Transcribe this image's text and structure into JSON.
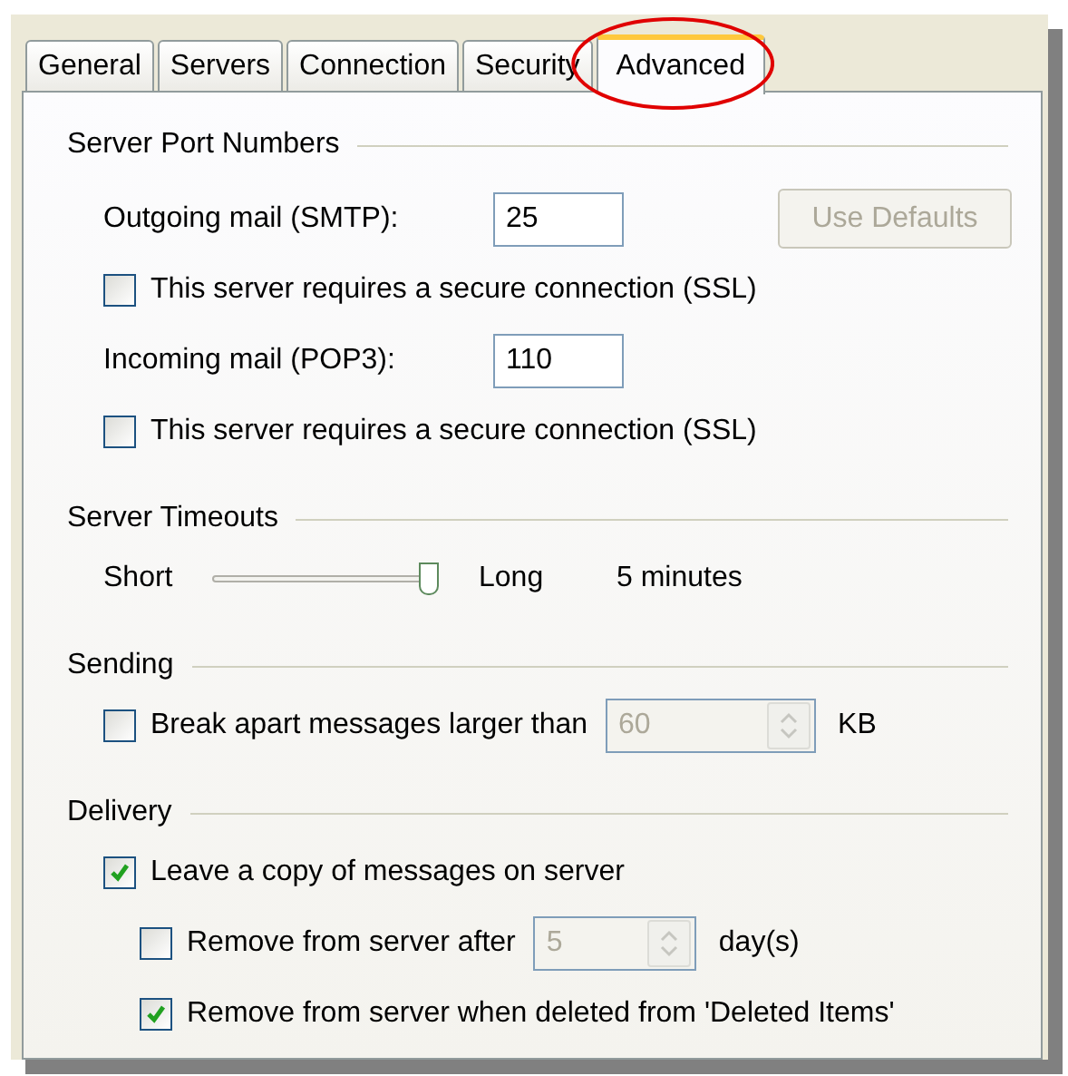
{
  "tabs": [
    {
      "label": "General",
      "selected": false
    },
    {
      "label": "Servers",
      "selected": false
    },
    {
      "label": "Connection",
      "selected": false
    },
    {
      "label": "Security",
      "selected": false
    },
    {
      "label": "Advanced",
      "selected": true
    }
  ],
  "sections": [
    {
      "title": "Server Port Numbers",
      "rows": [
        {
          "kind": "port",
          "label": "Outgoing mail (SMTP):",
          "value": "25",
          "button": {
            "label": "Use Defaults",
            "disabled": true
          }
        },
        {
          "kind": "checkbox",
          "label": "This server requires a secure connection (SSL)",
          "checked": false
        },
        {
          "kind": "port",
          "label": "Incoming mail (POP3):",
          "value": "110"
        },
        {
          "kind": "checkbox",
          "label": "This server requires a secure connection (SSL)",
          "checked": false
        }
      ]
    },
    {
      "title": "Server Timeouts",
      "rows": [
        {
          "kind": "slider",
          "min_label": "Short",
          "max_label": "Long",
          "level": 1,
          "reading": "5 minutes"
        }
      ]
    },
    {
      "title": "Sending",
      "rows": [
        {
          "kind": "spin_check",
          "label": "Break apart messages larger than",
          "checked": false,
          "value": "60",
          "unit": "KB",
          "disabled": true
        }
      ]
    },
    {
      "title": "Delivery",
      "rows": [
        {
          "kind": "checkbox",
          "label": "Leave a copy of messages on server",
          "checked": true,
          "children": [
            {
              "kind": "spin_check",
              "label": "Remove from server after",
              "checked": false,
              "value": "5",
              "unit": "day(s)",
              "disabled": true
            },
            {
              "kind": "checkbox",
              "label": "Remove from server when deleted from 'Deleted Items'",
              "checked": true
            }
          ]
        }
      ]
    }
  ]
}
